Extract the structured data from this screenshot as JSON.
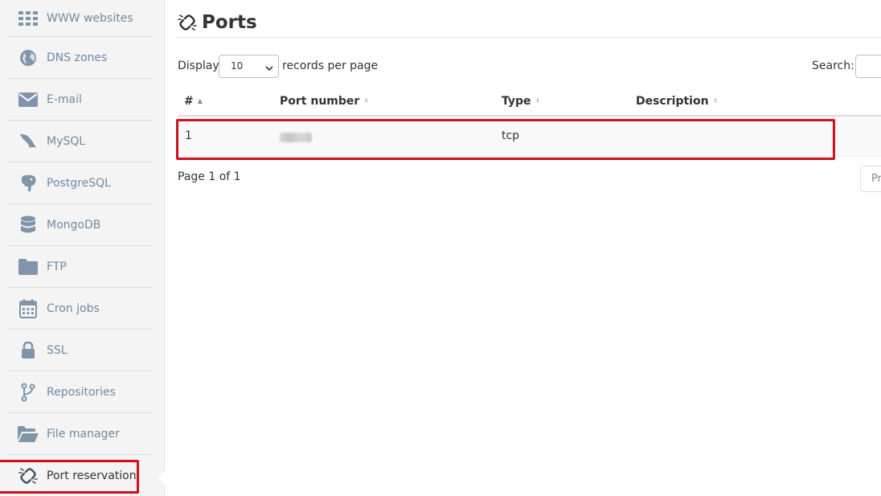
{
  "sidebar": {
    "items": [
      {
        "label": "WWW websites",
        "icon": "grid-icon"
      },
      {
        "label": "DNS zones",
        "icon": "globe-icon"
      },
      {
        "label": "E-mail",
        "icon": "envelope-icon"
      },
      {
        "label": "MySQL",
        "icon": "dolphin-icon"
      },
      {
        "label": "PostgreSQL",
        "icon": "elephant-icon"
      },
      {
        "label": "MongoDB",
        "icon": "database-icon"
      },
      {
        "label": "FTP",
        "icon": "folder-icon"
      },
      {
        "label": "Cron jobs",
        "icon": "calendar-icon"
      },
      {
        "label": "SSL",
        "icon": "lock-icon"
      },
      {
        "label": "Repositories",
        "icon": "branch-icon"
      },
      {
        "label": "File manager",
        "icon": "folder-open-icon"
      },
      {
        "label": "Port reservation",
        "icon": "broken-link-icon"
      }
    ]
  },
  "page": {
    "title": "Ports",
    "title_icon": "broken-link-icon"
  },
  "controls": {
    "display_label": "Display",
    "page_size": "10",
    "records_label": "records per page",
    "search_label": "Search:"
  },
  "table": {
    "columns": [
      "#",
      "Port number",
      "Type",
      "Description"
    ],
    "rows": [
      {
        "num": "1",
        "port": "",
        "type": "tcp",
        "description": ""
      }
    ]
  },
  "pagination": {
    "info": "Page 1 of 1",
    "prev_label": "Pr"
  },
  "colors": {
    "highlight": "#d0101a",
    "sidebar_text": "#6e8aa3",
    "icon": "#8195aa"
  }
}
